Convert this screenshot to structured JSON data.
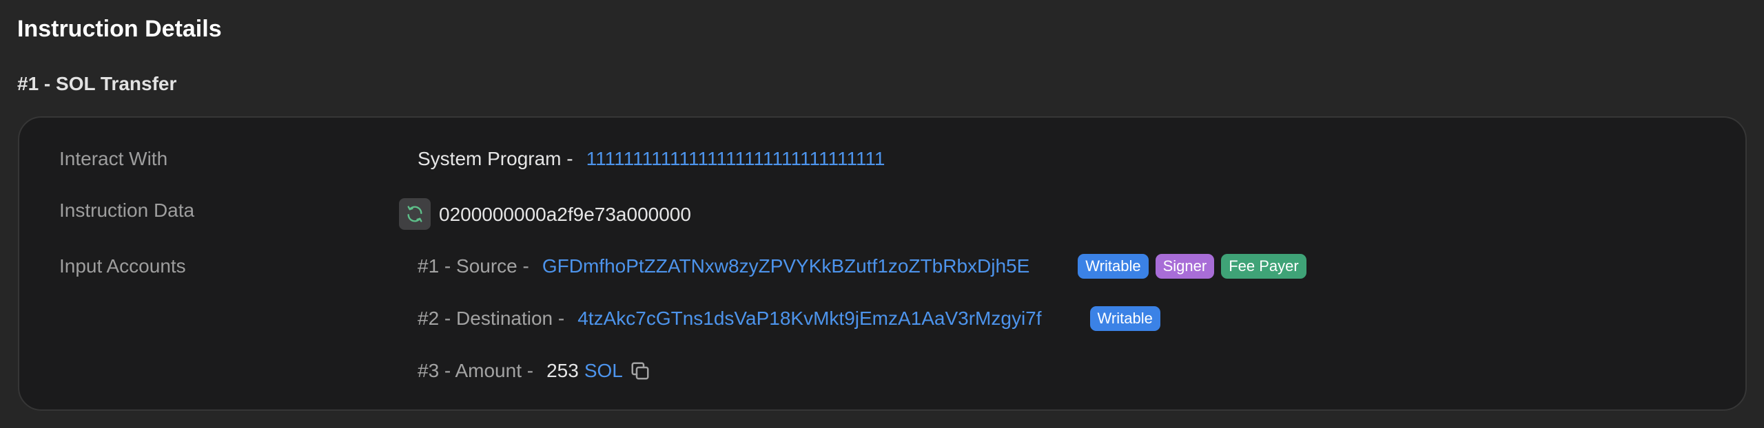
{
  "page_title": "Instruction Details",
  "instruction": {
    "title": "#1 - SOL Transfer",
    "interact_with": {
      "label": "Interact With",
      "program_name": "System Program -",
      "program_address": "11111111111111111111111111111111"
    },
    "instruction_data": {
      "label": "Instruction Data",
      "refresh_icon": "refresh-icon",
      "value": "0200000000a2f9e73a000000"
    },
    "input_accounts": {
      "label": "Input Accounts",
      "source": {
        "prefix": "#1 - Source -",
        "address": "GFDmfhoPtZZATNxw8zyZPVYKkBZutf1zoZTbRbxDjh5E",
        "badges": [
          "Writable",
          "Signer",
          "Fee Payer"
        ]
      },
      "destination": {
        "prefix": "#2 - Destination -",
        "address": "4tzAkc7cGTns1dsVaP18KvMkt9jEmzA1AaV3rMzgyi7f",
        "badges": [
          "Writable"
        ]
      },
      "amount": {
        "prefix": "#3 - Amount -",
        "value": "253",
        "unit": "SOL",
        "copy_icon": "copy-icon"
      }
    }
  },
  "colors": {
    "background": "#262626",
    "card": "#1b1b1c",
    "link": "#4d94ec",
    "writable": "#3b82e6",
    "signer": "#a86dd7",
    "fee_payer": "#3fa377"
  }
}
